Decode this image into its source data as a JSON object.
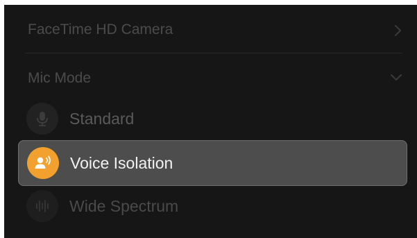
{
  "camera": {
    "label": "FaceTime HD Camera",
    "icon": "chevron-right-icon"
  },
  "mic_mode": {
    "label": "Mic Mode",
    "icon": "chevron-down-icon",
    "options": [
      {
        "label": "Standard",
        "icon": "microphone-icon",
        "selected": false
      },
      {
        "label": "Voice Isolation",
        "icon": "voice-isolation-icon",
        "selected": true
      },
      {
        "label": "Wide Spectrum",
        "icon": "wide-spectrum-icon",
        "selected": false
      }
    ]
  },
  "colors": {
    "panel_bg": "#161616",
    "selected_bg": "#4d4d4d",
    "accent": "#f2a12e",
    "dim_text": "#4b4b4b"
  }
}
